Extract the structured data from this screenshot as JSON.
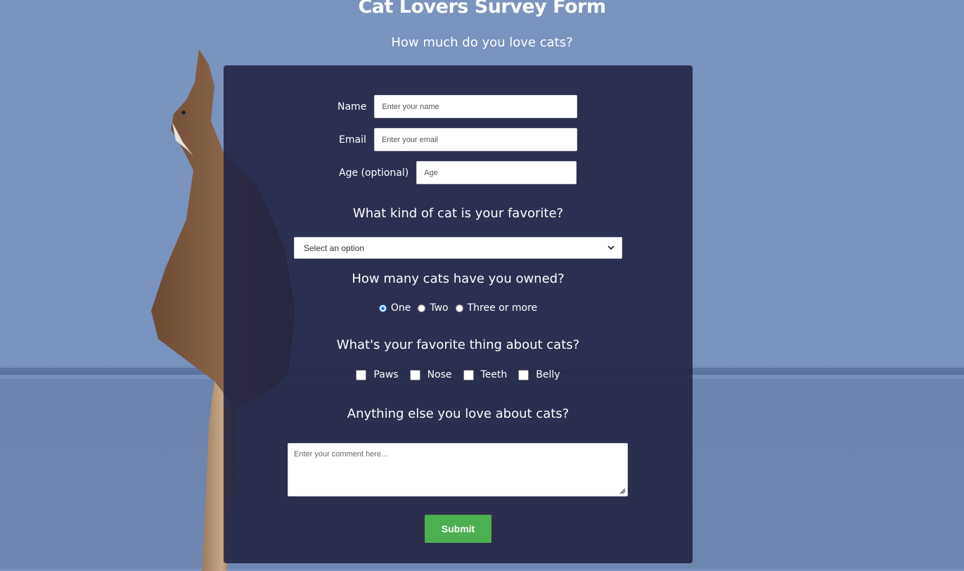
{
  "header": {
    "title": "Cat Lovers Survey Form",
    "subtitle": "How much do you love cats?"
  },
  "form": {
    "name": {
      "label": "Name",
      "placeholder": "Enter your name"
    },
    "email": {
      "label": "Email",
      "placeholder": "Enter your email"
    },
    "age": {
      "label": "Age (optional)",
      "placeholder": "Age"
    },
    "favorite_question": "What kind of cat is your favorite?",
    "favorite_select": {
      "selected": "Select an option"
    },
    "owned_question": "How many cats have you owned?",
    "owned_options": [
      {
        "label": "One",
        "checked": true
      },
      {
        "label": "Two",
        "checked": false
      },
      {
        "label": "Three or more",
        "checked": false
      }
    ],
    "thing_question": "What's your favorite thing about cats?",
    "thing_options": [
      {
        "label": "Paws",
        "checked": false
      },
      {
        "label": "Nose",
        "checked": false
      },
      {
        "label": "Teeth",
        "checked": false
      },
      {
        "label": "Belly",
        "checked": false
      }
    ],
    "comment_question": "Anything else you love about cats?",
    "comment_placeholder": "Enter your comment here...",
    "submit_label": "Submit"
  },
  "colors": {
    "panel": "#232644",
    "submit": "#4caf50",
    "radio_accent": "#1a73e8",
    "background_wall": "#7b93bf"
  }
}
